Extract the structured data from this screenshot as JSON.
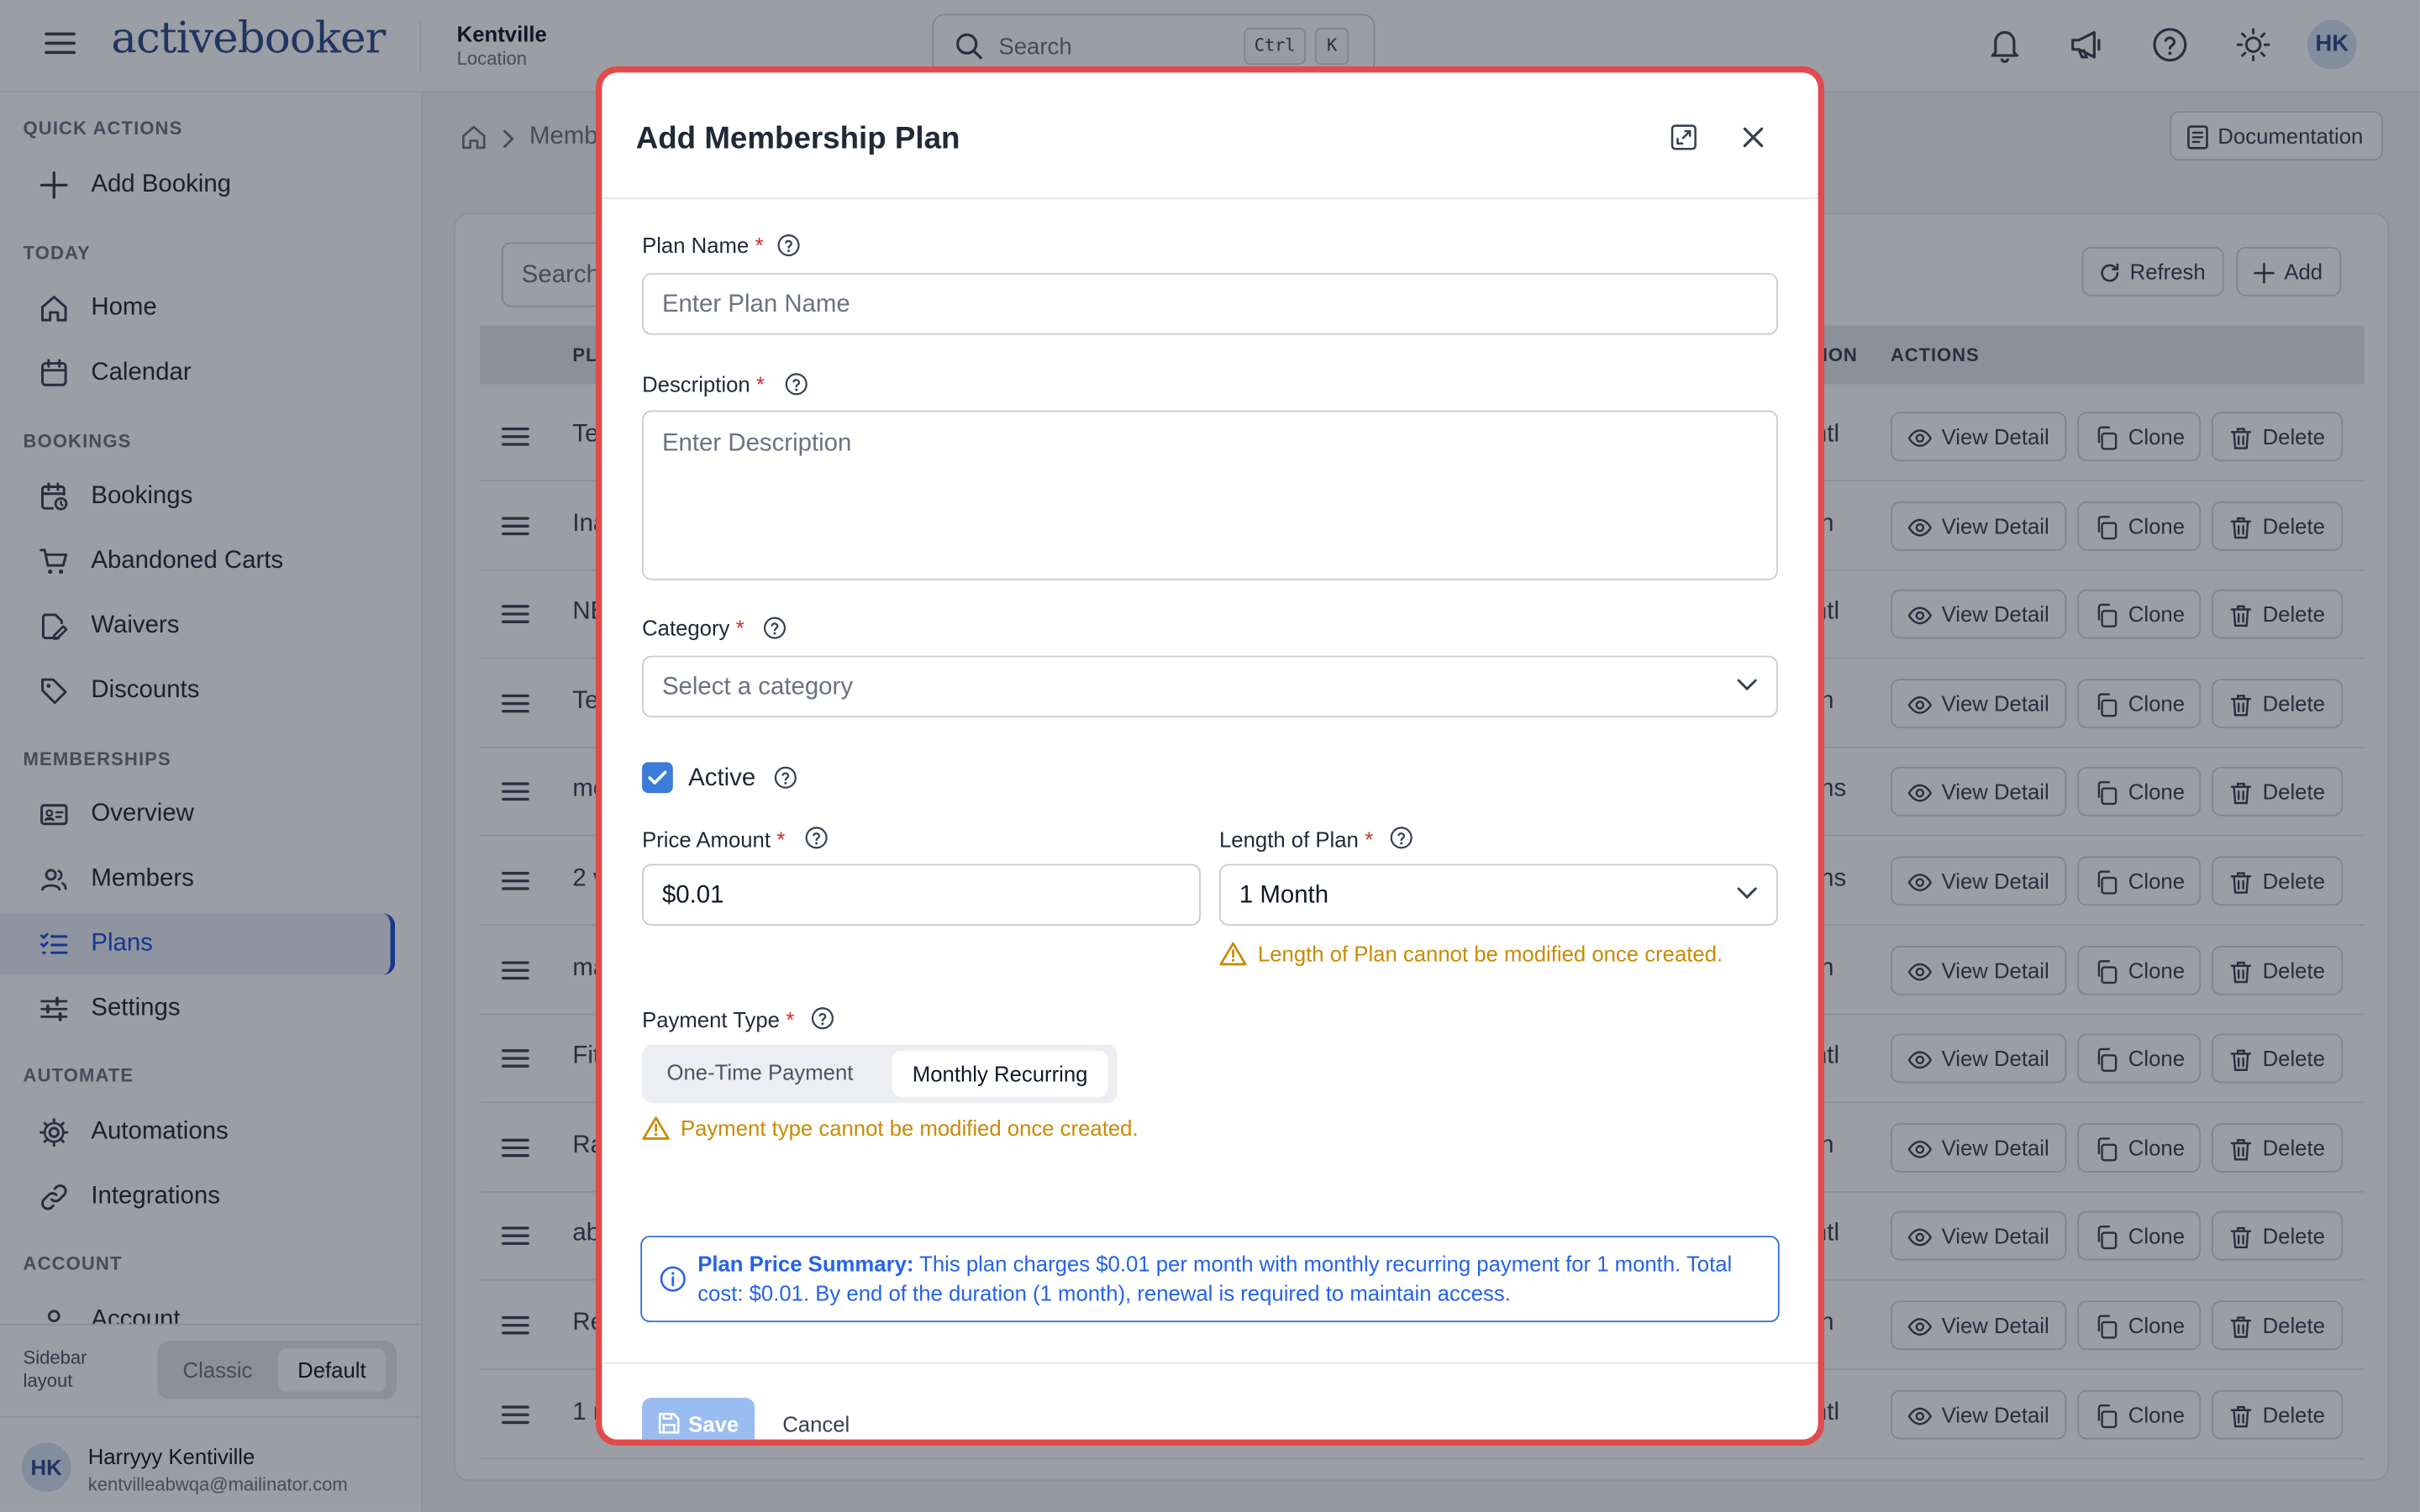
{
  "app": {
    "logo_text": "activebooker"
  },
  "location": {
    "name": "Kentville",
    "label": "Location"
  },
  "search": {
    "placeholder": "Search",
    "shortcut_key1": "Ctrl",
    "shortcut_key2": "K"
  },
  "user": {
    "initials": "HK",
    "name": "Harryyy Kentiville",
    "email": "kentvilleabwqa@mailinator.com"
  },
  "sidebar": {
    "sections": {
      "quick_actions": "QUICK ACTIONS",
      "today": "TODAY",
      "bookings": "BOOKINGS",
      "memberships": "MEMBERSHIPS",
      "automate": "AUTOMATE",
      "account": "ACCOUNT"
    },
    "items": {
      "add_booking": "Add Booking",
      "home": "Home",
      "calendar": "Calendar",
      "bookings": "Bookings",
      "abandoned_carts": "Abandoned Carts",
      "waivers": "Waivers",
      "discounts": "Discounts",
      "overview": "Overview",
      "members": "Members",
      "plans": "Plans",
      "settings": "Settings",
      "automations": "Automations",
      "integrations": "Integrations",
      "account": "Account"
    },
    "layout_label": "Sidebar layout",
    "layout_options": [
      "Classic",
      "Default"
    ],
    "layout_selected": "Default"
  },
  "page": {
    "breadcrumb": "Membe",
    "documentation": "Documentation",
    "table_search": "Search",
    "refresh": "Refresh",
    "add": "Add",
    "headers": {
      "plan": "PL",
      "duration": "TION",
      "actions": "ACTIONS"
    },
    "action_labels": {
      "view": "View Detail",
      "clone": "Clone",
      "delete": "Delete"
    },
    "rows": [
      {
        "name": "Tes",
        "duration": "ontl"
      },
      {
        "name": "Ina",
        "duration": "nth"
      },
      {
        "name": "NE",
        "duration": "ontl"
      },
      {
        "name": "Tes",
        "duration": "nth"
      },
      {
        "name": "mo",
        "duration": "nths"
      },
      {
        "name": "2 v",
        "duration": "nths"
      },
      {
        "name": "ma",
        "duration": "nth"
      },
      {
        "name": "Fit",
        "duration": "ontl"
      },
      {
        "name": "Ra",
        "duration": "nth"
      },
      {
        "name": "ab",
        "duration": "ontl"
      },
      {
        "name": "Ret",
        "duration": "nth"
      },
      {
        "name": "1 r",
        "duration": "ontl"
      }
    ]
  },
  "modal": {
    "title": "Add Membership Plan",
    "plan_name": {
      "label": "Plan Name",
      "placeholder": "Enter Plan Name"
    },
    "description": {
      "label": "Description",
      "placeholder": "Enter Description"
    },
    "category": {
      "label": "Category",
      "placeholder": "Select a category"
    },
    "active": {
      "label": "Active",
      "checked": true
    },
    "price": {
      "label": "Price Amount",
      "value": "$0.01"
    },
    "length": {
      "label": "Length of Plan",
      "value": "1 Month",
      "warning": "Length of Plan cannot be modified once created."
    },
    "payment_type": {
      "label": "Payment Type",
      "options": [
        "One-Time Payment",
        "Monthly Recurring"
      ],
      "selected": "Monthly Recurring",
      "warning": "Payment type cannot be modified once created."
    },
    "summary": {
      "title": "Plan Price Summary:",
      "text": "This plan charges $0.01 per month with monthly recurring payment for 1 month. Total cost: $0.01. By end of the duration (1 month), renewal is required to maintain access."
    },
    "save": "Save",
    "cancel": "Cancel"
  },
  "colors": {
    "brand": "#2b4b8c",
    "accent": "#1d4ed8",
    "warning": "#c98a05",
    "highlight_border": "#e24b4b",
    "checkbox": "#3b7bd9"
  }
}
